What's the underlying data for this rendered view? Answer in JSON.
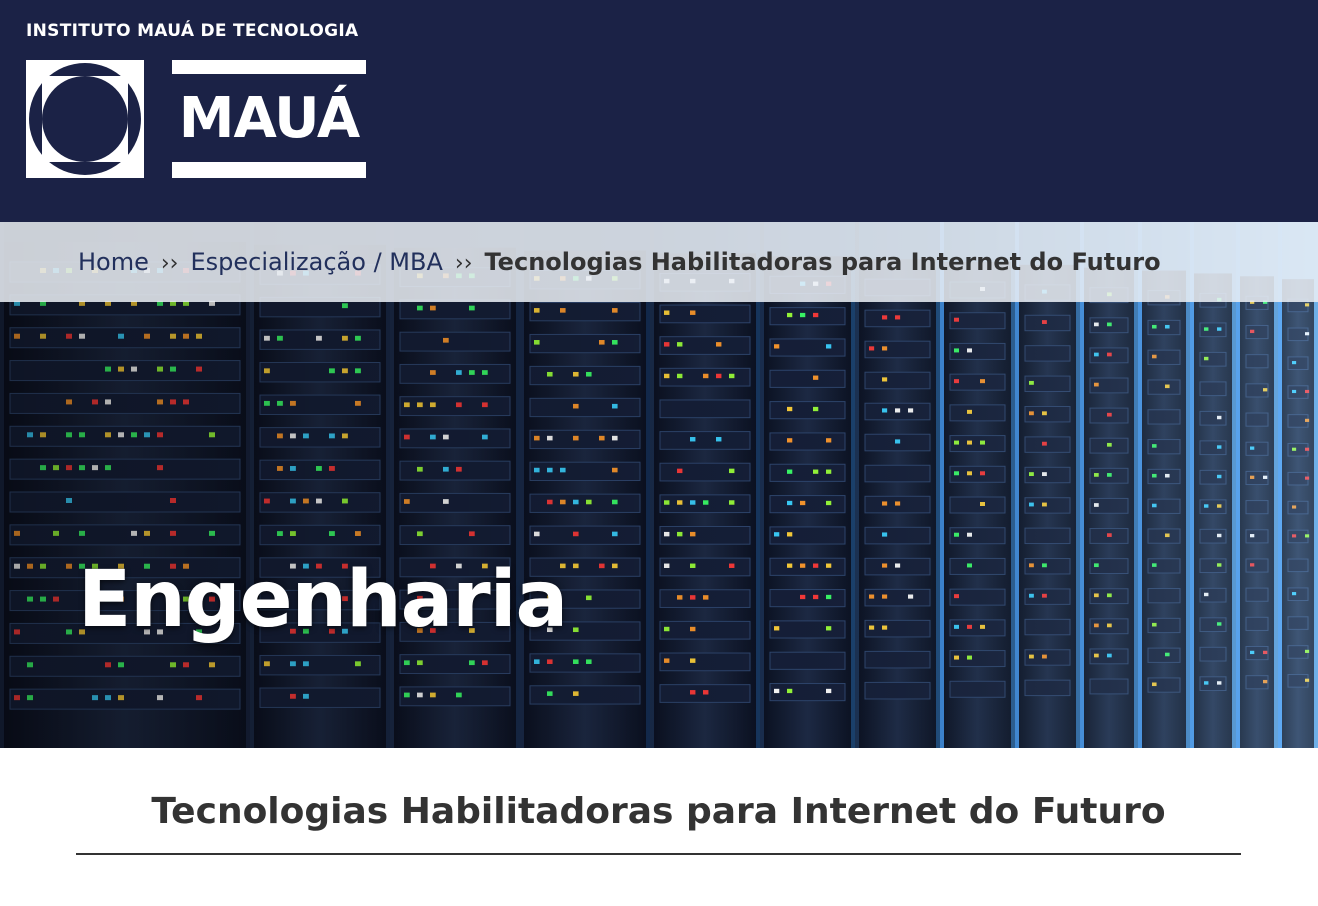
{
  "header": {
    "logo_tagline": "INSTITUTO MAUÁ DE TECNOLOGIA",
    "logo_wordmark": "MAUÁ",
    "background_color": "#1b2246"
  },
  "breadcrumb": {
    "items": [
      {
        "label": "Home"
      },
      {
        "label": "Especialização / MBA"
      }
    ],
    "separator": "››",
    "current": "Tecnologias Habilitadoras para Internet do Futuro"
  },
  "hero": {
    "title": "Engenharia",
    "image_subject": "server-racks-datacenter"
  },
  "main": {
    "heading": "Tecnologias Habilitadoras para Internet do Futuro"
  },
  "colors": {
    "navy": "#1b2246",
    "text_dark": "#333333",
    "link": "#22305c"
  }
}
